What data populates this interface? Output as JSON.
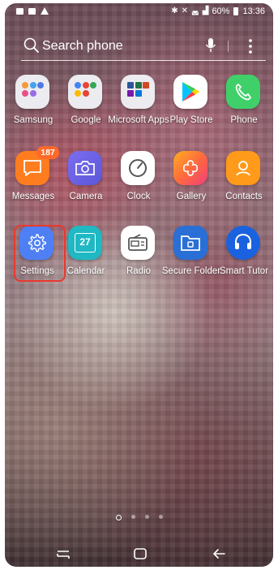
{
  "status_bar": {
    "battery": "60%",
    "time": "13:36"
  },
  "search": {
    "placeholder": "Search phone"
  },
  "apps": [
    {
      "name": "samsung",
      "label": "Samsung"
    },
    {
      "name": "google",
      "label": "Google"
    },
    {
      "name": "microsoft-apps",
      "label": "Microsoft Apps"
    },
    {
      "name": "play-store",
      "label": "Play Store"
    },
    {
      "name": "phone",
      "label": "Phone"
    },
    {
      "name": "messages",
      "label": "Messages",
      "badge": "187"
    },
    {
      "name": "camera",
      "label": "Camera"
    },
    {
      "name": "clock",
      "label": "Clock"
    },
    {
      "name": "gallery",
      "label": "Gallery"
    },
    {
      "name": "contacts",
      "label": "Contacts"
    },
    {
      "name": "settings",
      "label": "Settings"
    },
    {
      "name": "calendar",
      "label": "Calendar",
      "date": "27"
    },
    {
      "name": "radio",
      "label": "Radio"
    },
    {
      "name": "secure-folder",
      "label": "Secure Folder"
    },
    {
      "name": "smart-tutor",
      "label": "Smart Tutor"
    }
  ],
  "pager": {
    "pages": 4,
    "current": 1
  },
  "colors": {
    "highlight": "#e8392f",
    "messages": "#ff7d1e",
    "settings": "#4f7ff5",
    "phone": "#3fd06a"
  }
}
